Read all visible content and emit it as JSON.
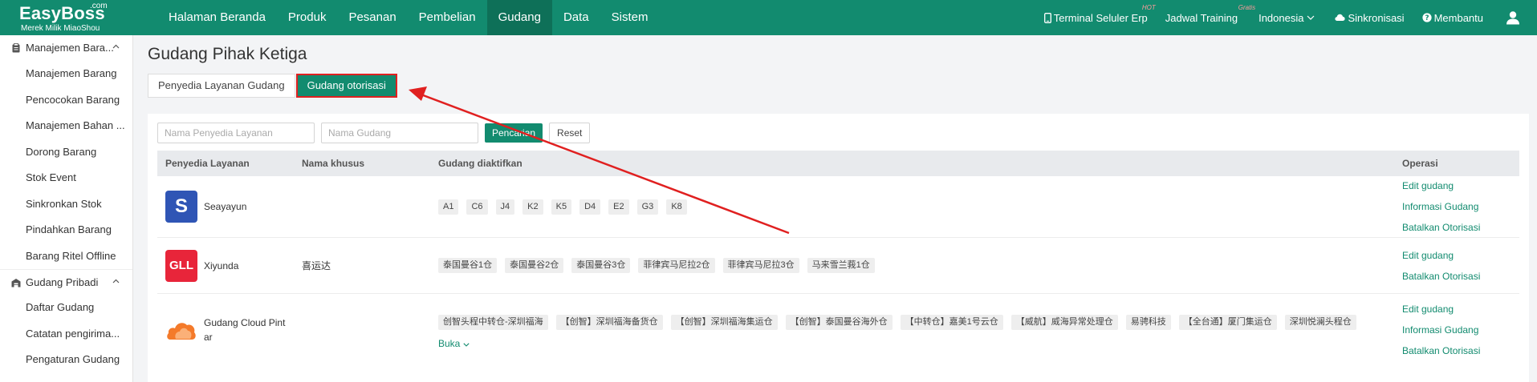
{
  "app": {
    "logo_main": "EasyBoss",
    "logo_com": ".com",
    "logo_sub": "Merek Milik MiaoShou"
  },
  "nav": [
    {
      "label": "Halaman Beranda",
      "active": false
    },
    {
      "label": "Produk",
      "active": false
    },
    {
      "label": "Pesanan",
      "active": false
    },
    {
      "label": "Pembelian",
      "active": false
    },
    {
      "label": "Gudang",
      "active": true
    },
    {
      "label": "Data",
      "active": false
    },
    {
      "label": "Sistem",
      "active": false
    }
  ],
  "top_right": {
    "mobile_label": "Terminal Seluler Erp",
    "mobile_badge": "HOT",
    "training_label": "Jadwal Training",
    "training_badge": "Gratis",
    "language_label": "Indonesia",
    "sync_label": "Sinkronisasi",
    "help_label": "Membantu"
  },
  "sidebar": {
    "group1": {
      "label": "Manajemen Bara...",
      "items": [
        "Manajemen Barang",
        "Pencocokan Barang",
        "Manajemen Bahan ...",
        "Dorong Barang",
        "Stok Event",
        "Sinkronkan Stok",
        "Pindahkan Barang",
        "Barang Ritel Offline"
      ]
    },
    "group2": {
      "label": "Gudang Pribadi",
      "items": [
        "Daftar Gudang",
        "Catatan pengirima...",
        "Pengaturan Gudang"
      ]
    }
  },
  "page": {
    "title": "Gudang Pihak Ketiga",
    "tab1": "Penyedia Layanan Gudang",
    "tab2": "Gudang otorisasi"
  },
  "filters": {
    "provider_placeholder": "Nama Penyedia Layanan",
    "warehouse_placeholder": "Nama Gudang",
    "search_label": "Pencarian",
    "reset_label": "Reset"
  },
  "table": {
    "headers": {
      "provider": "Penyedia Layanan",
      "custom_name": "Nama khusus",
      "warehouses": "Gudang diaktifkan",
      "operation": "Operasi"
    },
    "rows": [
      {
        "provider": "Seayayun",
        "logo_text": "S",
        "custom_name": "",
        "warehouses": [
          "A1",
          "C6",
          "J4",
          "K2",
          "K5",
          "D4",
          "E2",
          "G3",
          "K8"
        ],
        "ops": [
          "Edit gudang",
          "Informasi Gudang",
          "Batalkan Otorisasi"
        ]
      },
      {
        "provider": "Xiyunda",
        "logo_text": "GLL",
        "custom_name": "喜运达",
        "warehouses": [
          "泰国曼谷1仓",
          "泰国曼谷2仓",
          "泰国曼谷3仓",
          "菲律宾马尼拉2仓",
          "菲律宾马尼拉3仓",
          "马来雪兰莪1仓"
        ],
        "ops": [
          "Edit gudang",
          "Batalkan Otorisasi"
        ]
      },
      {
        "provider": "Gudang Cloud Pint ar",
        "logo_text": "",
        "custom_name": "",
        "warehouses": [
          "创智头程中转仓-深圳福海",
          "【创智】深圳福海备货仓",
          "【创智】深圳福海集运仓",
          "【创智】泰国曼谷海外仓",
          "【中转仓】嘉美1号云仓",
          "【威航】威海异常处理仓",
          "易骋科技",
          "【全台通】厦门集运仓",
          "深圳悦澜头程仓"
        ],
        "expand_label": "Buka",
        "ops": [
          "Edit gudang",
          "Informasi Gudang",
          "Batalkan Otorisasi"
        ]
      }
    ]
  },
  "colors": {
    "primary": "#128b6f",
    "primary_dark": "#0e7058",
    "highlight": "#e02020"
  }
}
